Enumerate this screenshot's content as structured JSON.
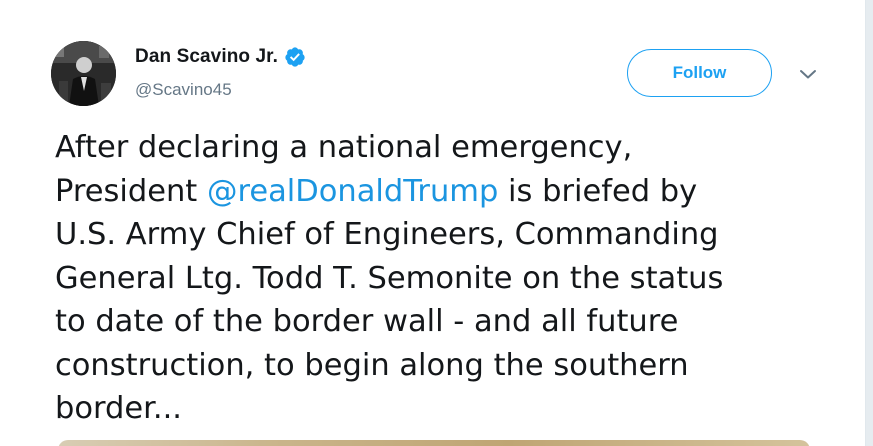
{
  "tweet": {
    "author": {
      "display_name": "Dan Scavino Jr.",
      "handle": "@Scavino45",
      "verified": true
    },
    "follow_label": "Follow",
    "text_lines": [
      {
        "before": "After declaring a national emergency,"
      },
      {
        "before": "President ",
        "mention": "@realDonaldTrump",
        "after": " is briefed by"
      },
      {
        "before": "U.S. Army Chief of Engineers, Commanding"
      },
      {
        "before": "General Ltg. Todd T. Semonite on the status"
      },
      {
        "before": "to date of the border wall - and all future"
      },
      {
        "before": "construction, to begin along the southern"
      },
      {
        "before": "border..."
      }
    ]
  },
  "icons": {
    "verified": "verified-badge-icon",
    "caret": "chevron-down-icon",
    "avatar": "profile-photo"
  },
  "colors": {
    "accent": "#1da1f2",
    "mention": "#1b95e0",
    "text": "#14171a",
    "secondary": "#657786"
  }
}
